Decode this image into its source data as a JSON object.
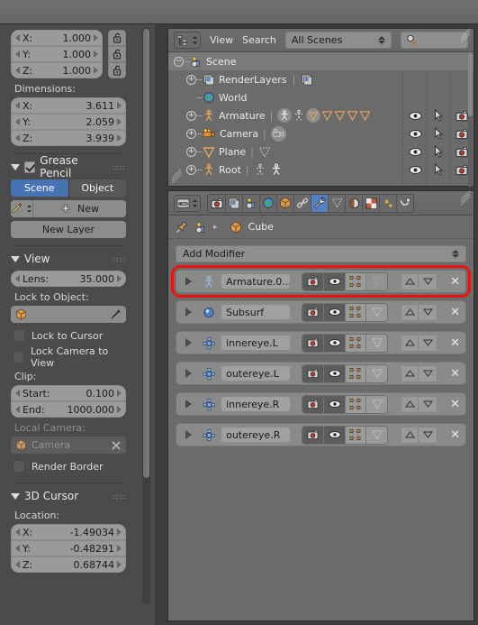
{
  "left_panel": {
    "scale_fields": [
      {
        "label": "X:",
        "value": "1.000"
      },
      {
        "label": "Y:",
        "value": "1.000"
      },
      {
        "label": "Z:",
        "value": "1.000"
      }
    ],
    "dimensions_label": "Dimensions:",
    "dimension_fields": [
      {
        "label": "X:",
        "value": "3.611"
      },
      {
        "label": "Y:",
        "value": "2.059"
      },
      {
        "label": "Z:",
        "value": "3.939"
      }
    ],
    "grease_pencil": {
      "title": "Grease Pencil",
      "checked": true,
      "tabs": [
        {
          "label": "Scene",
          "active": true
        },
        {
          "label": "Object",
          "active": false
        }
      ],
      "new_button": "New",
      "new_layer_button": "New Layer"
    },
    "view": {
      "title": "View",
      "lens": {
        "label": "Lens:",
        "value": "35.000"
      },
      "lock_to_object_label": "Lock to Object:",
      "lock_to_object_value": "",
      "lock_to_cursor": "Lock to Cursor",
      "lock_camera_to_view": "Lock Camera to View",
      "clip_label": "Clip:",
      "clip_start": {
        "label": "Start:",
        "value": "0.100"
      },
      "clip_end": {
        "label": "End:",
        "value": "1000.000"
      },
      "local_camera_label": "Local Camera:",
      "local_camera_value": "Camera",
      "render_border": "Render Border"
    },
    "cursor": {
      "title": "3D Cursor",
      "location_label": "Location:",
      "fields": [
        {
          "label": "X:",
          "value": "-1.49034"
        },
        {
          "label": "Y:",
          "value": "-0.48291"
        },
        {
          "label": "Z:",
          "value": "0.68744"
        }
      ]
    }
  },
  "outliner": {
    "header": {
      "editor_type_icon": "outliner-editor-icon",
      "menus": [
        "View",
        "Search"
      ],
      "display_mode": "All Scenes",
      "search_placeholder": "",
      "search_icon": "search-icon"
    },
    "rows": [
      {
        "name": "Scene",
        "indent": 0,
        "icon": "scene-icon",
        "selected": true,
        "expander": "minus",
        "badges": [],
        "show_columns": false
      },
      {
        "name": "RenderLayers",
        "indent": 1,
        "icon": "renderlayer-icon",
        "selected": false,
        "expander": "plus",
        "badges": [
          "renderlayer-icon"
        ],
        "show_columns": false
      },
      {
        "name": "World",
        "indent": 1,
        "icon": "world-icon",
        "selected": false,
        "expander": "none",
        "badges": [],
        "show_columns": false
      },
      {
        "name": "Armature",
        "indent": 1,
        "icon": "armature-icon",
        "selected": false,
        "expander": "plus",
        "badges": [
          "armature-data-icon",
          "pose-icon",
          "mesh-sel-icon",
          "mesh-icon",
          "mesh-icon",
          "mesh-icon",
          "mesh-icon"
        ],
        "show_columns": true
      },
      {
        "name": "Camera",
        "indent": 1,
        "icon": "camera-icon",
        "selected": false,
        "expander": "plus",
        "badges": [
          "camera-data-icon"
        ],
        "show_columns": true
      },
      {
        "name": "Plane",
        "indent": 1,
        "icon": "mesh-icon",
        "selected": false,
        "expander": "plus",
        "badges": [
          "mesh-data-icon"
        ],
        "show_columns": true
      },
      {
        "name": "Root",
        "indent": 1,
        "icon": "armature-icon",
        "selected": false,
        "expander": "plus",
        "badges": [
          "pose-icon",
          "armature-data-icon"
        ],
        "show_columns": true
      }
    ],
    "column_icons": [
      "eye-icon",
      "cursor-arrow-icon",
      "camera-render-icon"
    ]
  },
  "properties": {
    "editor_type_icon": "properties-editor-icon",
    "tabs": [
      {
        "name": "render-tab",
        "icon": "camera-render-icon",
        "active": false
      },
      {
        "name": "renderlayers-tab",
        "icon": "renderlayer-icon",
        "active": false
      },
      {
        "name": "scene-tab",
        "icon": "scene-icon",
        "active": false
      },
      {
        "name": "world-tab",
        "icon": "world-icon",
        "active": false
      },
      {
        "name": "object-tab",
        "icon": "object-cube-icon",
        "active": false
      },
      {
        "name": "constraints-tab",
        "icon": "chain-link-icon",
        "active": false
      },
      {
        "name": "modifiers-tab",
        "icon": "wrench-icon",
        "active": true
      },
      {
        "name": "data-tab",
        "icon": "mesh-data-icon",
        "active": false
      },
      {
        "name": "material-tab",
        "icon": "material-sphere-icon",
        "active": false
      },
      {
        "name": "texture-tab",
        "icon": "checker-texture-icon",
        "active": false
      },
      {
        "name": "particles-tab",
        "icon": "particles-icon",
        "active": false
      },
      {
        "name": "physics-tab",
        "icon": "physics-icon",
        "active": false
      }
    ],
    "breadcrumb": {
      "pin_icon": "pin-icon",
      "scene_icon": "scene-icon",
      "separator": "▸",
      "object_icon": "object-cube-icon",
      "object_name": "Cube"
    },
    "add_modifier": "Add Modifier",
    "modifiers": [
      {
        "name": "Armature.0...",
        "icon": "armature-modifier-icon",
        "highlighted": true,
        "toggles": [
          {
            "icon": "camera-render-icon",
            "state": "on"
          },
          {
            "icon": "eye-icon",
            "state": "on"
          },
          {
            "icon": "edit-mode-icon",
            "state": "off"
          },
          {
            "icon": "cage-icon",
            "state": "disabled"
          }
        ]
      },
      {
        "name": "Subsurf",
        "icon": "subsurf-modifier-icon",
        "highlighted": false,
        "toggles": [
          {
            "icon": "camera-render-icon",
            "state": "on"
          },
          {
            "icon": "eye-icon",
            "state": "on"
          },
          {
            "icon": "edit-mode-icon",
            "state": "off"
          },
          {
            "icon": "cage-icon",
            "state": "off"
          }
        ]
      },
      {
        "name": "innereye.L",
        "icon": "hook-modifier-icon",
        "highlighted": false,
        "toggles": [
          {
            "icon": "camera-render-icon",
            "state": "on"
          },
          {
            "icon": "eye-icon",
            "state": "on"
          },
          {
            "icon": "edit-mode-icon",
            "state": "off"
          },
          {
            "icon": "cage-icon",
            "state": "off"
          }
        ]
      },
      {
        "name": "outereye.L",
        "icon": "hook-modifier-icon",
        "highlighted": false,
        "toggles": [
          {
            "icon": "camera-render-icon",
            "state": "on"
          },
          {
            "icon": "eye-icon",
            "state": "on"
          },
          {
            "icon": "edit-mode-icon",
            "state": "off"
          },
          {
            "icon": "cage-icon",
            "state": "off"
          }
        ]
      },
      {
        "name": "innereye.R",
        "icon": "hook-modifier-icon",
        "highlighted": false,
        "toggles": [
          {
            "icon": "camera-render-icon",
            "state": "on"
          },
          {
            "icon": "eye-icon",
            "state": "on"
          },
          {
            "icon": "edit-mode-icon",
            "state": "off"
          },
          {
            "icon": "cage-icon",
            "state": "off"
          }
        ]
      },
      {
        "name": "outereye.R",
        "icon": "hook-modifier-icon",
        "highlighted": false,
        "toggles": [
          {
            "icon": "camera-render-icon",
            "state": "on"
          },
          {
            "icon": "eye-icon",
            "state": "on"
          },
          {
            "icon": "edit-mode-icon",
            "state": "off"
          },
          {
            "icon": "cage-icon",
            "state": "off"
          }
        ]
      }
    ],
    "row_buttons": {
      "move_up": "△",
      "move_down": "▽",
      "delete": "✕"
    }
  },
  "colors": {
    "accent_blue": "#4772b3",
    "highlight_red": "#ee1111",
    "panel_bg": "#4b4b4b",
    "editor_bg": "#6b6b6b",
    "field_bg": "#8e8e8e",
    "bone_orange": "#e8a45c"
  }
}
